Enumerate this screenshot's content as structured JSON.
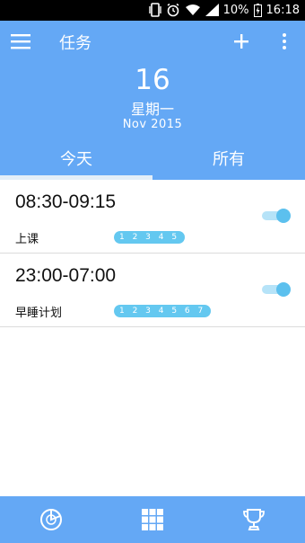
{
  "status_bar": {
    "battery": "10%",
    "time": "16:18"
  },
  "toolbar": {
    "title": "任务"
  },
  "date": {
    "day": "16",
    "weekday": "星期一",
    "month_year": "Nov  2015"
  },
  "tabs": [
    {
      "label": "今天",
      "selected": true
    },
    {
      "label": "所有",
      "selected": false
    }
  ],
  "tasks": [
    {
      "time": "08:30-09:15",
      "name": "上课",
      "days": "1 2 3 4 5",
      "enabled": true
    },
    {
      "time": "23:00-07:00",
      "name": "早睡计划",
      "days": "1 2 3 4 5 6 7",
      "enabled": true
    }
  ],
  "colors": {
    "primary": "#64a8f5",
    "accent": "#5cc0ee",
    "status_bar": "#000000"
  },
  "icons": {
    "menu": "menu-icon",
    "add": "add-icon",
    "more": "more-vert-icon",
    "nav": [
      "timer-icon",
      "grid-icon",
      "trophy-icon"
    ]
  }
}
